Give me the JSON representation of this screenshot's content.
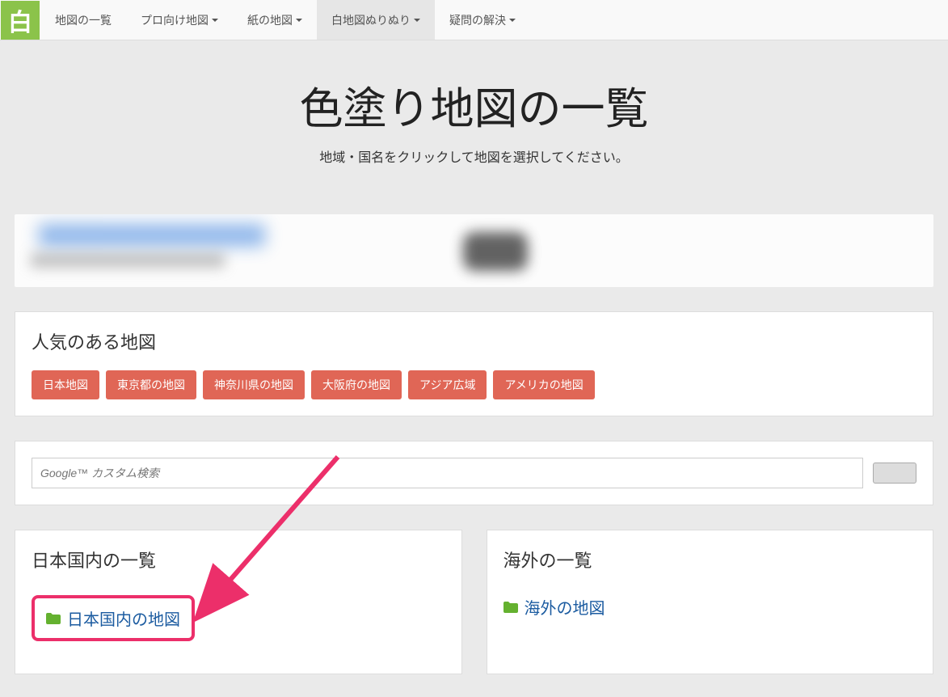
{
  "brand": "白",
  "nav": {
    "items": [
      {
        "label": "地図の一覧",
        "dropdown": false
      },
      {
        "label": "プロ向け地図",
        "dropdown": true
      },
      {
        "label": "紙の地図",
        "dropdown": true
      },
      {
        "label": "白地図ぬりぬり",
        "dropdown": true,
        "active": true
      },
      {
        "label": "疑問の解決",
        "dropdown": true
      }
    ]
  },
  "hero": {
    "title": "色塗り地図の一覧",
    "subtitle": "地域・国名をクリックして地図を選択してください。"
  },
  "popular": {
    "heading": "人気のある地図",
    "items": [
      "日本地図",
      "東京都の地図",
      "神奈川県の地図",
      "大阪府の地図",
      "アジア広域",
      "アメリカの地図"
    ]
  },
  "search": {
    "placeholder": "Google™ カスタム検索"
  },
  "domestic": {
    "heading": "日本国内の一覧",
    "link": "日本国内の地図"
  },
  "overseas": {
    "heading": "海外の一覧",
    "link": "海外の地図"
  }
}
